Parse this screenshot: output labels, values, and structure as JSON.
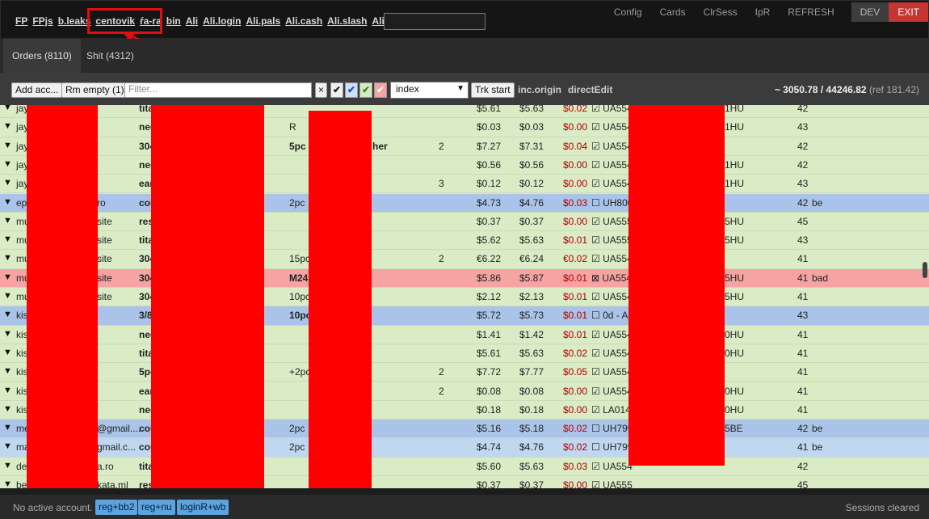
{
  "topbar": {
    "links": [
      "FP",
      "FPjs",
      "b.leaks",
      "centovik",
      "ŕa-ra",
      "bin",
      "Ali",
      "Ali.login",
      "Ali.pals",
      "Ali.cash",
      "Ali.slash",
      "Ali.c"
    ],
    "buttons": [
      "Config",
      "Cards",
      "ClrSess",
      "IpR",
      "REFRESH",
      "DEV",
      "EXIT"
    ]
  },
  "tabs": [
    {
      "label": "Orders (8110)"
    },
    {
      "label": "Shit (4312)"
    }
  ],
  "toolbar": {
    "add_label": "Add acc...",
    "rm_label": "Rm empty (1)",
    "filter_placeholder": "Filter...",
    "clear_label": "×",
    "checks": [
      "✔",
      "✔",
      "✔",
      "✔"
    ],
    "select_value": "index",
    "trk_label": "Trk start",
    "inc_label": "inc.origin",
    "direct_label": "directEdit",
    "totals": "~ 3050.78 / 44246.82",
    "ref": "(ref 181.42)"
  },
  "rows": [
    {
      "color": "green",
      "name": "jay",
      "site": "",
      "type": "tita",
      "pc": "",
      "qty": "",
      "p1": "$5.61",
      "p2": "$5.63",
      "diff": "$0.02",
      "track": "☑ UA554",
      "cc": "1HU",
      "n": "42",
      "note": ""
    },
    {
      "color": "green",
      "name": "jay",
      "site": "",
      "type": "nec",
      "pc": "R",
      "qty": "",
      "p1": "$0.03",
      "p2": "$0.03",
      "diff": "$0.00",
      "track": "☑ UA554",
      "cc": "1HU",
      "n": "43",
      "note": ""
    },
    {
      "color": "green",
      "name": "jay",
      "site": "",
      "type": "304",
      "pc": "5pc",
      "pcExtra": "her",
      "qty": "2",
      "p1": "$7.27",
      "p2": "$7.31",
      "diff": "$0.04",
      "track": "☑ UA554",
      "cc": "",
      "n": "42",
      "note": ""
    },
    {
      "color": "green",
      "name": "jay",
      "site": "",
      "type": "nec",
      "pc": "",
      "qty": "",
      "p1": "$0.56",
      "p2": "$0.56",
      "diff": "$0.00",
      "track": "☑ UA554",
      "cc": "1HU",
      "n": "42",
      "note": ""
    },
    {
      "color": "green",
      "name": "jay",
      "site": "",
      "type": "ear",
      "pc": "",
      "qty": "3",
      "p1": "$0.12",
      "p2": "$0.12",
      "diff": "$0.00",
      "track": "☑ UA554",
      "cc": "1HU",
      "n": "43",
      "note": ""
    },
    {
      "color": "blue",
      "name": "ep",
      "site": "ro",
      "type": "cou",
      "pc": "2pc",
      "qty": "",
      "p1": "$4.73",
      "p2": "$4.76",
      "diff": "$0.03",
      "track": "☐ UH800",
      "cc": "",
      "n": "42",
      "note": "be"
    },
    {
      "color": "green",
      "name": "mu",
      "site": "site",
      "type": "res",
      "pc": "",
      "qty": "",
      "p1": "$0.37",
      "p2": "$0.37",
      "diff": "$0.00",
      "track": "☑ UA555",
      "cc": "5HU",
      "n": "45",
      "note": ""
    },
    {
      "color": "green",
      "name": "mu",
      "site": "site",
      "type": "tita",
      "pc": "",
      "qty": "",
      "p1": "$5.62",
      "p2": "$5.63",
      "diff": "$0.01",
      "track": "☑ UA555",
      "cc": "5HU",
      "n": "43",
      "note": ""
    },
    {
      "color": "green",
      "name": "mu",
      "site": "site",
      "type": "304",
      "pc": "15pc",
      "qty": "2",
      "p1": "€6.22",
      "p2": "€6.24",
      "diff": "€0.02",
      "track": "☑ UA554",
      "cc": "",
      "n": "41",
      "note": ""
    },
    {
      "color": "red",
      "name": "mu",
      "site": "site",
      "type": "304",
      "pc": "M24",
      "qty": "",
      "p1": "$5.86",
      "p2": "$5.87",
      "diff": "$0.01",
      "track": "⊠ UA554",
      "cc": "5HU",
      "n": "41",
      "note": "bad"
    },
    {
      "color": "green",
      "name": "mu",
      "site": "site",
      "type": "304",
      "pc": "10pc",
      "qty": "",
      "p1": "$2.12",
      "p2": "$2.13",
      "diff": "$0.01",
      "track": "☑ UA554",
      "cc": "5HU",
      "n": "41",
      "note": ""
    },
    {
      "color": "blue",
      "name": "kis",
      "site": "",
      "type": "3/8",
      "pc": "10pc",
      "qty": "",
      "p1": "$5.72",
      "p2": "$5.73",
      "diff": "$0.01",
      "track": "☐ 0d - Ar",
      "cc": "",
      "n": "43",
      "note": ""
    },
    {
      "color": "green",
      "name": "kis",
      "site": "",
      "type": "nec",
      "pc": "",
      "qty": "",
      "p1": "$1.41",
      "p2": "$1.42",
      "diff": "$0.01",
      "track": "☑ UA554",
      "cc": "0HU",
      "n": "41",
      "note": ""
    },
    {
      "color": "green",
      "name": "kis",
      "site": "",
      "type": "tita",
      "pc": "",
      "qty": "",
      "p1": "$5.61",
      "p2": "$5.63",
      "diff": "$0.02",
      "track": "☑ UA554",
      "cc": "0HU",
      "n": "41",
      "note": ""
    },
    {
      "color": "green",
      "name": "kis",
      "site": "",
      "type": "5pc",
      "pc": "+2pc",
      "qty": "2",
      "p1": "$7.72",
      "p2": "$7.77",
      "diff": "$0.05",
      "track": "☑ UA554",
      "cc": "",
      "n": "41",
      "note": ""
    },
    {
      "color": "green",
      "name": "kis",
      "site": "",
      "type": "ear",
      "pc": "",
      "qty": "2",
      "p1": "$0.08",
      "p2": "$0.08",
      "diff": "$0.00",
      "track": "☑ UA554",
      "cc": "0HU",
      "n": "41",
      "note": ""
    },
    {
      "color": "green",
      "name": "kis",
      "site": "",
      "type": "nec",
      "pc": "",
      "qty": "",
      "p1": "$0.18",
      "p2": "$0.18",
      "diff": "$0.00",
      "track": "☑ LA014",
      "cc": "0HU",
      "n": "41",
      "note": ""
    },
    {
      "color": "blue",
      "name": "me",
      "site": "@gmail....",
      "type": "cou",
      "pc": "2pc",
      "qty": "",
      "p1": "$5.16",
      "p2": "$5.18",
      "diff": "$0.02",
      "track": "☐ UH799",
      "cc": "5BE",
      "n": "42",
      "note": "be"
    },
    {
      "color": "lblue",
      "name": "ma",
      "site": "gmail.c...",
      "type": "cou",
      "pc": "2pc",
      "qty": "",
      "p1": "$4.74",
      "p2": "$4.76",
      "diff": "$0.02",
      "track": "☐ UH799",
      "cc": "",
      "n": "41",
      "note": "be"
    },
    {
      "color": "green",
      "name": "de",
      "site": "a.ro",
      "type": "tita",
      "pc": "",
      "qty": "",
      "p1": "$5.60",
      "p2": "$5.63",
      "diff": "$0.03",
      "track": "☑ UA554",
      "cc": "",
      "n": "42",
      "note": ""
    },
    {
      "color": "green",
      "name": "be",
      "site": "kata.ml",
      "type": "res",
      "pc": "",
      "qty": "",
      "p1": "$0.37",
      "p2": "$0.37",
      "diff": "$0.00",
      "track": "☑ UA555",
      "cc": "",
      "n": "45",
      "note": ""
    }
  ],
  "statusbar": {
    "status": "No active account.",
    "buttons": [
      "reg+bb2",
      "reg+nu",
      "loginR+wb"
    ],
    "sessions": "Sessions cleared"
  },
  "colors": {
    "green": "#d9ecc6",
    "blue": "#a9c4e8",
    "red": "#f5a3a3",
    "redact": "#ff0000",
    "exit": "#c63434"
  }
}
